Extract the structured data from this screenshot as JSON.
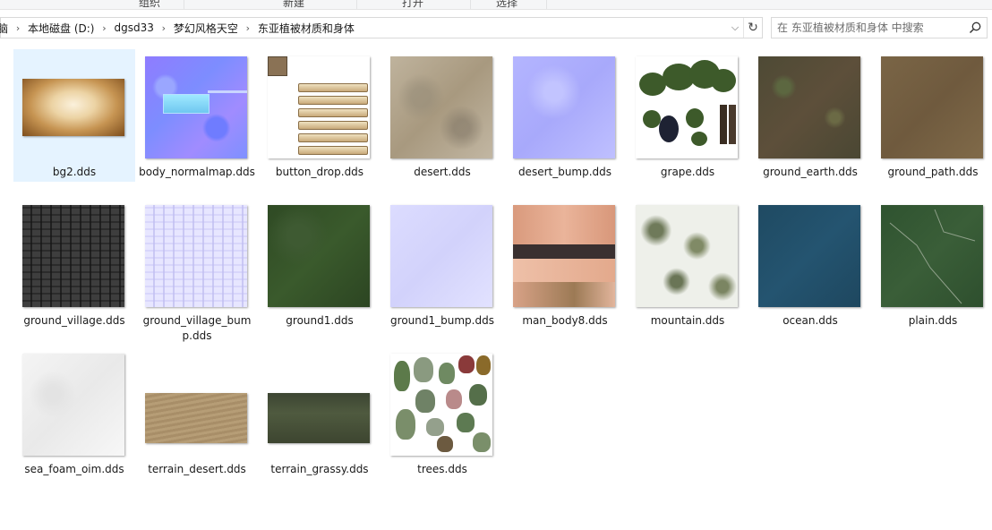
{
  "ribbon": {
    "groups": [
      {
        "label": "组织"
      },
      {
        "label": "新建"
      },
      {
        "label": "打开"
      },
      {
        "label": "选择"
      }
    ]
  },
  "address": {
    "crumbs": [
      {
        "label": "脑"
      },
      {
        "label": "本地磁盘 (D:)"
      },
      {
        "label": "dgsd33"
      },
      {
        "label": "梦幻风格天空"
      },
      {
        "label": "东亚植被材质和身体"
      }
    ],
    "separator": "›",
    "dropdown_icon": "chevron-down-icon",
    "refresh_icon": "refresh-icon"
  },
  "search": {
    "placeholder": "在 东亚植被材质和身体 中搜索",
    "icon": "search-icon"
  },
  "files": [
    {
      "name": "bg2.dds",
      "selected": true
    },
    {
      "name": "body_normalmap.dds"
    },
    {
      "name": "button_drop.dds"
    },
    {
      "name": "desert.dds"
    },
    {
      "name": "desert_bump.dds"
    },
    {
      "name": "grape.dds"
    },
    {
      "name": "ground_earth.dds"
    },
    {
      "name": "ground_path.dds"
    },
    {
      "name": "ground_village.dds"
    },
    {
      "name": "ground_village_bump.dds"
    },
    {
      "name": "ground1.dds"
    },
    {
      "name": "ground1_bump.dds"
    },
    {
      "name": "man_body8.dds"
    },
    {
      "name": "mountain.dds"
    },
    {
      "name": "ocean.dds"
    },
    {
      "name": "plain.dds"
    },
    {
      "name": "sea_foam_oim.dds"
    },
    {
      "name": "terrain_desert.dds"
    },
    {
      "name": "terrain_grassy.dds"
    },
    {
      "name": "trees.dds"
    }
  ],
  "colors": {
    "selection": "#e5f3ff",
    "border": "#d9d9d9"
  }
}
